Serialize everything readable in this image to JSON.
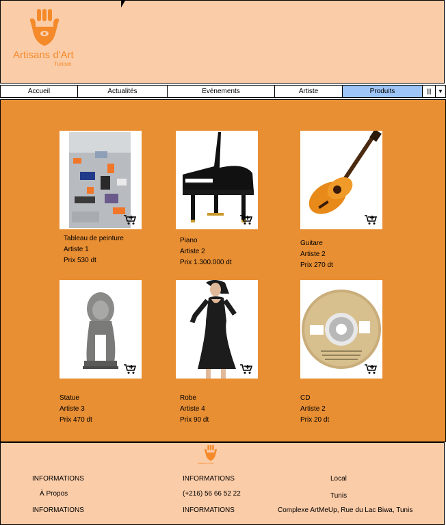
{
  "brand": {
    "name": "Artisans d'Art",
    "subtitle": "Tunisie",
    "color": "#f48a2a"
  },
  "nav": {
    "items": [
      "Accueil",
      "Actualités",
      "Evénements",
      "Artiste",
      "Produits"
    ],
    "active": "Produits",
    "menu_icon": "grid-menu-icon",
    "dropdown_icon": "chevron-down-icon"
  },
  "products": [
    {
      "name": "Tableau de peinture",
      "artist": "Artiste 1",
      "price": "Prix 530 dt",
      "image": "abstract-painting"
    },
    {
      "name": "Piano",
      "artist": "Artiste 2",
      "price": "Prix 1.300.000 dt",
      "image": "grand-piano"
    },
    {
      "name": "Guitare",
      "artist": "Artiste 2",
      "price": "Prix 270 dt",
      "image": "acoustic-guitar"
    },
    {
      "name": "Statue",
      "artist": "Artiste 3",
      "price": "Prix 470 dt",
      "image": "lion-statue"
    },
    {
      "name": "Robe",
      "artist": "Artiste 4",
      "price": "Prix 90 dt",
      "image": "black-dress"
    },
    {
      "name": "CD",
      "artist": "Artiste 2",
      "price": "Prix 20 dt",
      "image": "compact-disc"
    }
  ],
  "footer": {
    "col1": [
      "INFORMATIONS",
      "À Propos",
      "INFORMATIONS"
    ],
    "col2": [
      "INFORMATIONS",
      "(+216) 56 66 52 22",
      "INFORMATIONS"
    ],
    "col3": [
      "Local",
      "Tunis",
      "Complexe ArtMeUp, Rue du Lac Biwa, Tunis"
    ]
  },
  "colors": {
    "header_bg": "#fbcca8",
    "main_bg": "#e88e33",
    "active_tab": "#9ec5f7"
  }
}
